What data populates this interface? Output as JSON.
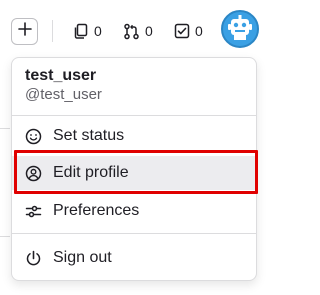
{
  "header": {
    "new_button_icon": "plus-icon",
    "counters": [
      {
        "name": "issues",
        "icon": "issues-copy-icon",
        "count": "0"
      },
      {
        "name": "merge-requests",
        "icon": "merge-request-icon",
        "count": "0"
      },
      {
        "name": "todos",
        "icon": "todo-checkbox-icon",
        "count": "0"
      }
    ],
    "avatar_icon": "robot-avatar-icon"
  },
  "user_menu": {
    "name": "test_user",
    "handle": "@test_user",
    "items": [
      {
        "label": "Set status",
        "icon": "smiley-icon"
      },
      {
        "label": "Edit profile",
        "icon": "user-circle-icon",
        "highlighted": true
      },
      {
        "label": "Preferences",
        "icon": "sliders-icon"
      },
      {
        "label": "Sign out",
        "icon": "power-icon"
      }
    ]
  },
  "colors": {
    "highlight_border": "#e00000",
    "avatar_bg": "#3aa0e4",
    "hover_bg": "#ececef"
  }
}
